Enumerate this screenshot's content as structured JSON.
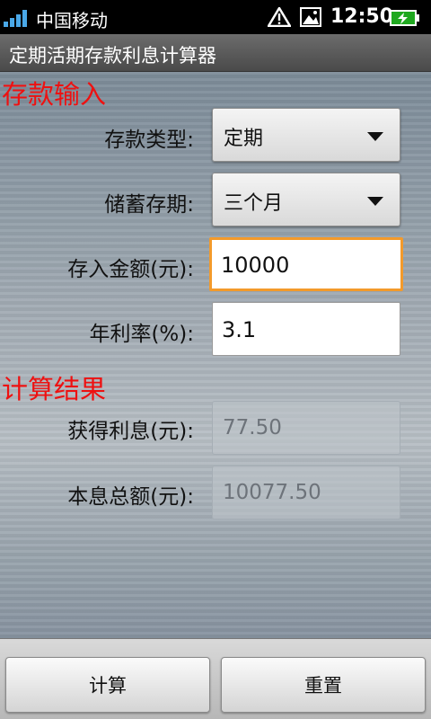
{
  "status_bar": {
    "carrier": "中国移动",
    "time": "12:50",
    "icons": [
      "signal-icon",
      "warning-icon",
      "photo-icon",
      "battery-charging-icon"
    ]
  },
  "app": {
    "title": "定期活期存款利息计算器"
  },
  "input_section": {
    "title": "存款输入",
    "deposit_type": {
      "label": "存款类型:",
      "value": "定期"
    },
    "term": {
      "label": "储蓄存期:",
      "value": "三个月"
    },
    "amount": {
      "label": "存入金额(元):",
      "value": "10000"
    },
    "rate": {
      "label": "年利率(%):",
      "value": "3.1"
    }
  },
  "result_section": {
    "title": "计算结果",
    "interest": {
      "label": "获得利息(元):",
      "value": "77.50"
    },
    "total": {
      "label": "本息总额(元):",
      "value": "10077.50"
    }
  },
  "buttons": {
    "calculate": "计算",
    "reset": "重置"
  },
  "colors": {
    "section_title": "#ee1111",
    "focus_border": "#f39a2b"
  }
}
